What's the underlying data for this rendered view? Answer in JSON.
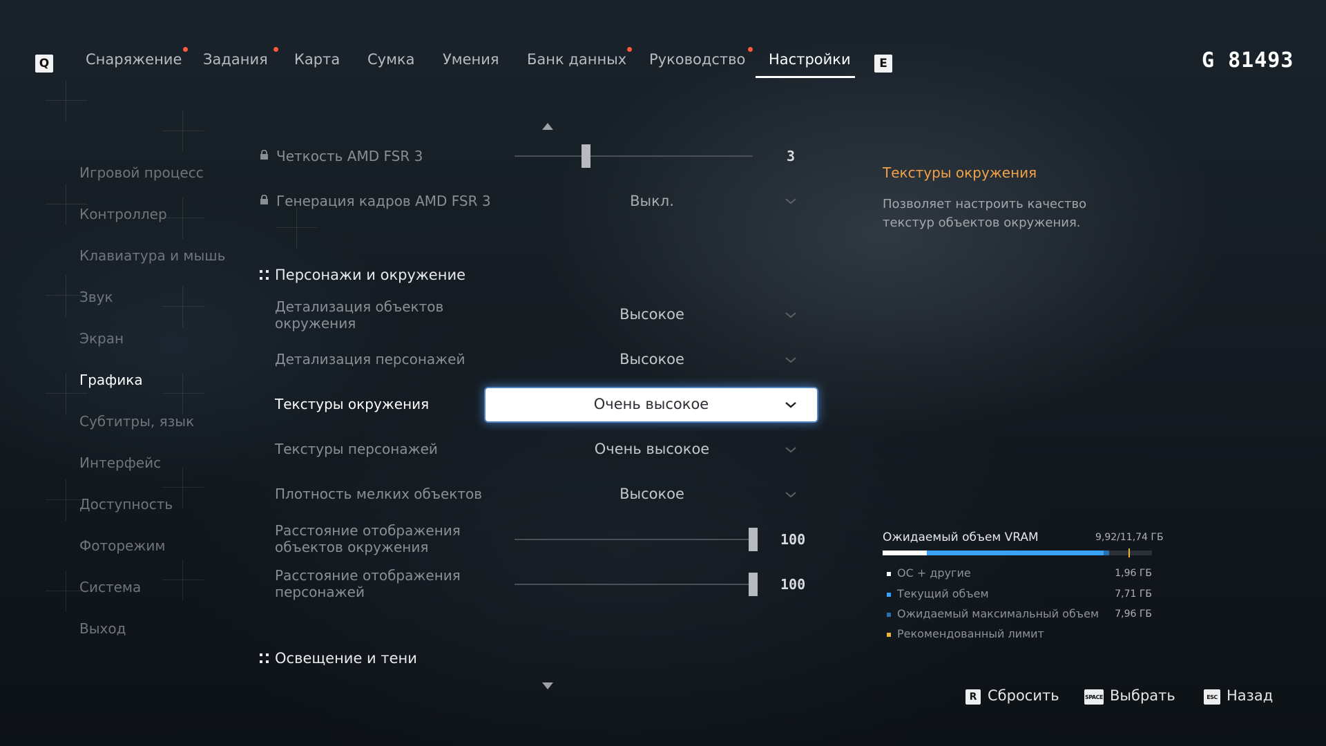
{
  "nav": {
    "left_key": "Q",
    "right_key": "E",
    "tabs": [
      {
        "label": "Снаряжение",
        "dot": true
      },
      {
        "label": "Задания",
        "dot": true
      },
      {
        "label": "Карта",
        "dot": false
      },
      {
        "label": "Сумка",
        "dot": false
      },
      {
        "label": "Умения",
        "dot": false
      },
      {
        "label": "Банк данных",
        "dot": true
      },
      {
        "label": "Руководство",
        "dot": true
      },
      {
        "label": "Настройки",
        "dot": false,
        "active": true
      }
    ],
    "currency": "G 81493",
    "dot_color": "#ff5a3c"
  },
  "sidebar": {
    "items": [
      {
        "label": "Игровой процесс"
      },
      {
        "label": "Контроллер"
      },
      {
        "label": "Клавиатура и мышь"
      },
      {
        "label": "Звук"
      },
      {
        "label": "Экран"
      },
      {
        "label": "Графика",
        "active": true
      },
      {
        "label": "Субтитры, язык"
      },
      {
        "label": "Интерфейс"
      },
      {
        "label": "Доступность"
      },
      {
        "label": "Фоторежим"
      },
      {
        "label": "Система"
      },
      {
        "label": "Выход"
      }
    ]
  },
  "settings": {
    "fsr_sharpness": {
      "label": "Четкость AMD FSR 3",
      "value": "3",
      "locked": true,
      "level_fraction": 0.3
    },
    "fsr_framegen": {
      "label": "Генерация кадров AMD FSR 3",
      "value": "Выкл.",
      "locked": true
    },
    "section_characters": "Персонажи и окружение",
    "env_detail": {
      "label_1": "Детализация объектов",
      "label_2": "окружения",
      "value": "Высокое"
    },
    "char_detail": {
      "label": "Детализация персонажей",
      "value": "Высокое"
    },
    "env_textures": {
      "label": "Текстуры окружения",
      "value": "Очень высокое",
      "selected": true
    },
    "char_textures": {
      "label": "Текстуры персонажей",
      "value": "Очень высокое"
    },
    "small_density": {
      "label": "Плотность мелких объектов",
      "value": "Высокое"
    },
    "env_distance": {
      "label_1": "Расстояние отображения",
      "label_2": "объектов окружения",
      "value": "100",
      "level_fraction": 1.0
    },
    "char_distance": {
      "label_1": "Расстояние отображения",
      "label_2": "персонажей",
      "value": "100",
      "level_fraction": 1.0
    },
    "section_lighting": "Освещение и тени"
  },
  "info": {
    "title": "Текстуры окружения",
    "description": "Позволяет настроить качество текстур объектов окружения.",
    "title_color": "#f0a14a"
  },
  "vram": {
    "title": "Ожидаемый объем VRAM",
    "total": "9,92/11,74",
    "unit": "ГБ",
    "legend": [
      {
        "label": "ОС + другие",
        "value": "1,96",
        "color": "#ffffff"
      },
      {
        "label": "Текущий объем",
        "value": "7,71",
        "color": "#3aa3ff"
      },
      {
        "label": "Ожидаемый максимальный объем",
        "value": "7,96",
        "color": "#2a6fb0"
      },
      {
        "label": "Рекомендованный лимит",
        "value": "",
        "color": "#f0b43a"
      }
    ]
  },
  "hints": {
    "reset_key": "R",
    "reset_label": "Сбросить",
    "select_key": "SPACE",
    "select_label": "Выбрать",
    "back_key": "ESC",
    "back_label": "Назад"
  }
}
